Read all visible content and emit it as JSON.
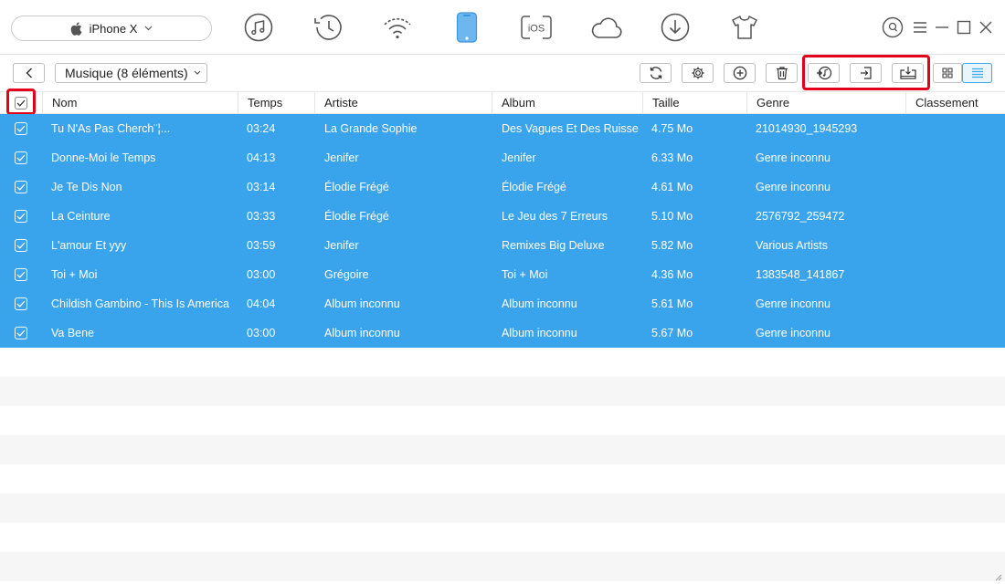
{
  "topbar": {
    "device_name": "iPhone X",
    "nav_icons": [
      "music-icon",
      "history-icon",
      "wifi-sync-icon",
      "device-icon",
      "ios-transfer-icon",
      "icloud-icon",
      "download-icon",
      "tshirt-icon"
    ],
    "active_nav": "device-icon",
    "ios_label": "iOS"
  },
  "toolbar": {
    "category_label": "Musique (8 éléments)"
  },
  "table": {
    "columns": [
      "Nom",
      "Temps",
      "Artiste",
      "Album",
      "Taille",
      "Genre",
      "Classement"
    ],
    "rows": [
      {
        "nom": "Tu N'As Pas Cherch¨¦...",
        "temps": "03:24",
        "artiste": "La Grande Sophie",
        "album": "Des Vagues Et Des Ruisse...",
        "taille": "4.75 Mo",
        "genre": "21014930_1945293"
      },
      {
        "nom": "Donne-Moi le Temps",
        "temps": "04:13",
        "artiste": "Jenifer",
        "album": "Jenifer",
        "taille": "6.33 Mo",
        "genre": "Genre inconnu"
      },
      {
        "nom": "Je Te Dis Non",
        "temps": "03:14",
        "artiste": "Élodie Frégé",
        "album": "Élodie Frégé",
        "taille": "4.61 Mo",
        "genre": "Genre inconnu"
      },
      {
        "nom": "La Ceinture",
        "temps": "03:33",
        "artiste": "Élodie Frégé",
        "album": "Le Jeu des 7 Erreurs",
        "taille": "5.10 Mo",
        "genre": "2576792_259472"
      },
      {
        "nom": "L'amour Et yyy",
        "temps": "03:59",
        "artiste": "Jenifer",
        "album": "Remixes Big Deluxe",
        "taille": "5.82 Mo",
        "genre": "Various Artists"
      },
      {
        "nom": "Toi + Moi",
        "temps": "03:00",
        "artiste": "Grégoire",
        "album": "Toi + Moi",
        "taille": "4.36 Mo",
        "genre": "1383548_141867"
      },
      {
        "nom": "Childish Gambino - This Is America",
        "temps": "04:04",
        "artiste": "Album inconnu",
        "album": "Album inconnu",
        "taille": "5.61 Mo",
        "genre": "Genre inconnu"
      },
      {
        "nom": "Va Bene",
        "temps": "03:00",
        "artiste": "Album inconnu",
        "album": "Album inconnu",
        "taille": "5.67 Mo",
        "genre": "Genre inconnu"
      }
    ]
  },
  "colors": {
    "selected_row": "#39a3ec",
    "accent": "#3ea7e6",
    "highlight_box": "#e3001b",
    "alt_row": "#f6f6f6"
  }
}
